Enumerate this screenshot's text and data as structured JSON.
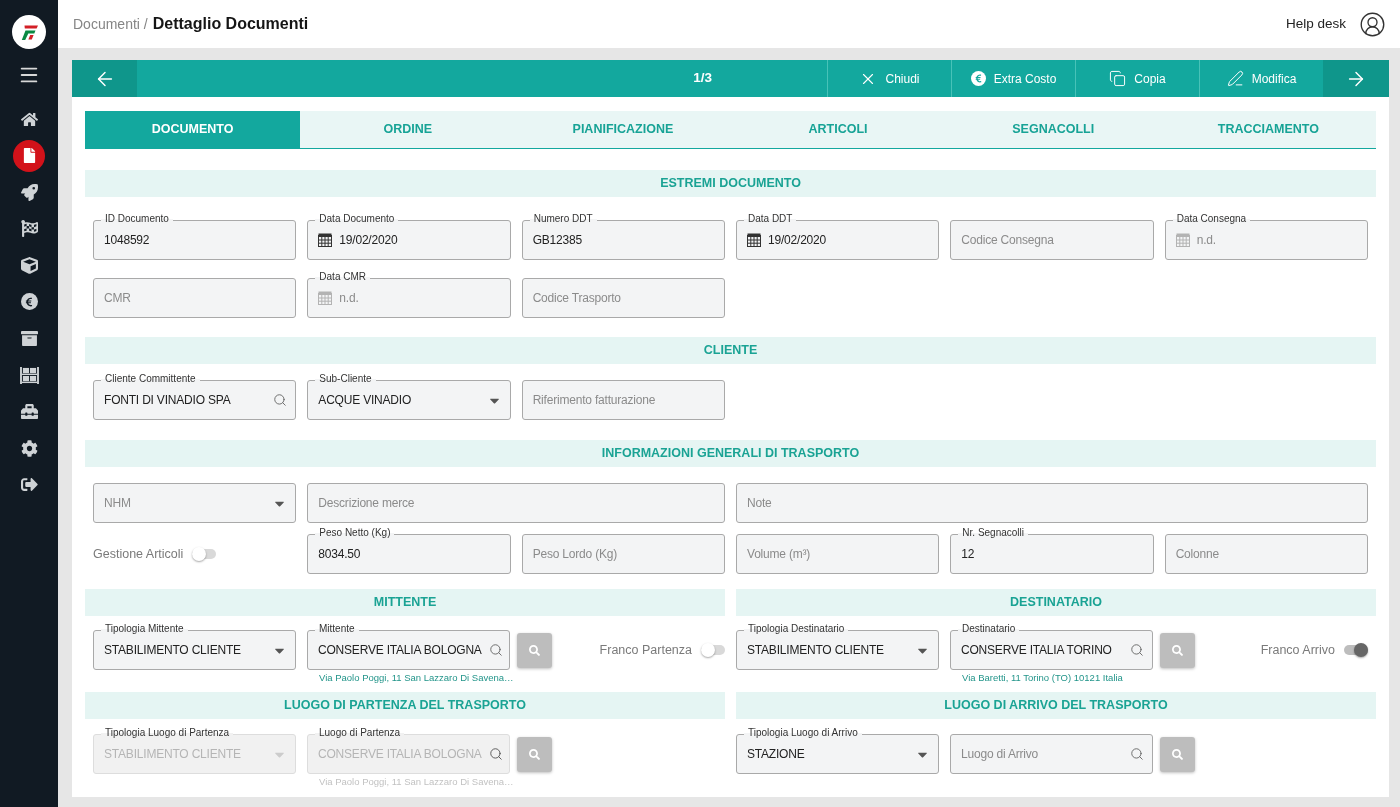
{
  "sidebar": {
    "items": [
      {
        "selected": false
      },
      {
        "selected": true
      },
      {
        "selected": false
      },
      {
        "selected": false
      },
      {
        "selected": false
      },
      {
        "selected": false
      },
      {
        "selected": false
      },
      {
        "selected": false
      },
      {
        "selected": false
      },
      {
        "selected": false
      },
      {
        "selected": false
      }
    ]
  },
  "header": {
    "breadcrumb_parent": "Documenti /",
    "title": "Dettaglio Documenti",
    "help_link": "Help desk"
  },
  "toolbar": {
    "counter": "1/3",
    "actions": [
      "Chiudi",
      "Extra Costo",
      "Copia",
      "Modifica"
    ]
  },
  "tabs": [
    {
      "label": "DOCUMENTO",
      "selected": true
    },
    {
      "label": "ORDINE",
      "selected": false
    },
    {
      "label": "PIANIFICAZIONE",
      "selected": false
    },
    {
      "label": "ARTICOLI",
      "selected": false
    },
    {
      "label": "SEGNACOLLI",
      "selected": false
    },
    {
      "label": "TRACCIAMENTO",
      "selected": false
    }
  ],
  "sections": [
    {
      "kind": "full",
      "title": "ESTREMI DOCUMENTO",
      "fields": [
        {
          "kind": "text",
          "label": "ID Documento",
          "value": "1048592"
        },
        {
          "kind": "date",
          "label": "Data Documento",
          "value": "19/02/2020"
        },
        {
          "kind": "text",
          "label": "Numero DDT",
          "value": "GB12385"
        },
        {
          "kind": "date",
          "label": "Data DDT",
          "value": "19/02/2020"
        },
        {
          "kind": "text",
          "placeholder": "Codice Consegna"
        },
        {
          "kind": "date",
          "label": "Data Consegna",
          "placeholder": "n.d."
        },
        {
          "kind": "text",
          "placeholder": "CMR"
        },
        {
          "kind": "date",
          "label": "Data CMR",
          "placeholder": "n.d."
        },
        {
          "kind": "text",
          "placeholder": "Codice Trasporto"
        }
      ]
    },
    {
      "kind": "full",
      "title": "CLIENTE",
      "fields": [
        {
          "kind": "search",
          "label": "Cliente Committente",
          "value": "FONTI DI VINADIO SPA"
        },
        {
          "kind": "select",
          "label": "Sub-Cliente",
          "value": "ACQUE VINADIO"
        },
        {
          "kind": "text",
          "placeholder": "Riferimento fatturazione"
        }
      ]
    },
    {
      "kind": "full",
      "title": "INFORMAZIONI GENERALI DI TRASPORTO",
      "fields": [
        {
          "kind": "select",
          "placeholder": "NHM"
        },
        {
          "kind": "text",
          "placeholder": "Descrizione merce"
        },
        {
          "kind": "text",
          "placeholder": "Note"
        },
        {
          "kind": "toggle",
          "label": "Gestione Articoli",
          "on": false
        },
        {
          "kind": "text",
          "label": "Peso Netto (Kg)",
          "value": "8034.50"
        },
        {
          "kind": "text",
          "placeholder": "Peso Lordo (Kg)"
        },
        {
          "kind": "text",
          "placeholder": "Volume (m³)"
        },
        {
          "kind": "text",
          "label": "Nr. Segnacolli",
          "value": "12"
        },
        {
          "kind": "text",
          "placeholder": "Colonne"
        }
      ]
    },
    {
      "kind": "half",
      "title": "MITTENTE",
      "fields": [
        {
          "kind": "select",
          "label": "Tipologia Mittente",
          "value": "STABILIMENTO CLIENTE"
        },
        {
          "kind": "lookup",
          "label": "Mittente",
          "value": "CONSERVE ITALIA BOLOGNA",
          "hint": "Via Paolo Poggi, 11 San Lazzaro Di Savena…"
        },
        {
          "kind": "toggle",
          "label": "Franco Partenza",
          "on": false
        }
      ]
    },
    {
      "kind": "half",
      "title": "DESTINATARIO",
      "fields": [
        {
          "kind": "select",
          "label": "Tipologia Destinatario",
          "value": "STABILIMENTO CLIENTE"
        },
        {
          "kind": "lookup",
          "label": "Destinatario",
          "value": "CONSERVE ITALIA TORINO",
          "hint": "Via Baretti, 11 Torino (TO) 10121 Italia"
        },
        {
          "kind": "toggle",
          "label": "Franco Arrivo",
          "on": true
        }
      ]
    },
    {
      "kind": "half",
      "title": "LUOGO DI PARTENZA DEL TRASPORTO",
      "fields": [
        {
          "kind": "select",
          "label": "Tipologia Luogo di Partenza",
          "value": "STABILIMENTO CLIENTE",
          "disabled": true
        },
        {
          "kind": "lookup",
          "label": "Luogo di Partenza",
          "value": "CONSERVE ITALIA BOLOGNA",
          "hint": "Via Paolo Poggi, 11 San Lazzaro Di Savena…",
          "disabled": true
        }
      ]
    },
    {
      "kind": "half",
      "title": "LUOGO DI ARRIVO DEL TRASPORTO",
      "fields": [
        {
          "kind": "select",
          "label": "Tipologia Luogo di Arrivo",
          "value": "STAZIONE",
          "disabled": false
        },
        {
          "kind": "lookup",
          "placeholder": "Luogo di Arrivo",
          "disabled": false
        }
      ]
    }
  ]
}
